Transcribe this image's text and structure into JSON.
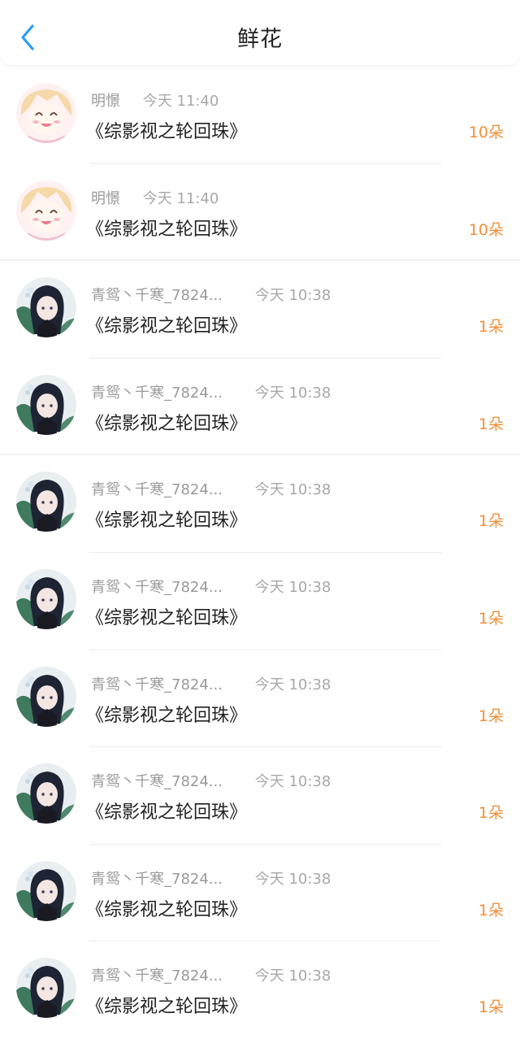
{
  "header": {
    "title": "鲜花",
    "back_icon": "chevron-left-icon",
    "accent_color": "#2b9cf2"
  },
  "colors": {
    "amount": "#f08f3a",
    "meta": "#9a9a9a",
    "text": "#222222"
  },
  "gifts": [
    {
      "user": "明憬",
      "time": "今天 11:40",
      "book": "《综影视之轮回珠》",
      "amount": "10朵",
      "avatar": "pink-anime-avatar"
    },
    {
      "user": "明憬",
      "time": "今天 11:40",
      "book": "《综影视之轮回珠》",
      "amount": "10朵",
      "avatar": "pink-anime-avatar"
    },
    {
      "user": "青鸳丶千寒_7824...",
      "time": "今天 10:38",
      "book": "《综影视之轮回珠》",
      "amount": "1朵",
      "avatar": "dark-hair-anime-avatar"
    },
    {
      "user": "青鸳丶千寒_7824...",
      "time": "今天 10:38",
      "book": "《综影视之轮回珠》",
      "amount": "1朵",
      "avatar": "dark-hair-anime-avatar"
    },
    {
      "user": "青鸳丶千寒_7824...",
      "time": "今天 10:38",
      "book": "《综影视之轮回珠》",
      "amount": "1朵",
      "avatar": "dark-hair-anime-avatar"
    },
    {
      "user": "青鸳丶千寒_7824...",
      "time": "今天 10:38",
      "book": "《综影视之轮回珠》",
      "amount": "1朵",
      "avatar": "dark-hair-anime-avatar"
    },
    {
      "user": "青鸳丶千寒_7824...",
      "time": "今天 10:38",
      "book": "《综影视之轮回珠》",
      "amount": "1朵",
      "avatar": "dark-hair-anime-avatar"
    },
    {
      "user": "青鸳丶千寒_7824...",
      "time": "今天 10:38",
      "book": "《综影视之轮回珠》",
      "amount": "1朵",
      "avatar": "dark-hair-anime-avatar"
    },
    {
      "user": "青鸳丶千寒_7824...",
      "time": "今天 10:38",
      "book": "《综影视之轮回珠》",
      "amount": "1朵",
      "avatar": "dark-hair-anime-avatar"
    },
    {
      "user": "青鸳丶千寒_7824...",
      "time": "今天 10:38",
      "book": "《综影视之轮回珠》",
      "amount": "1朵",
      "avatar": "dark-hair-anime-avatar"
    }
  ]
}
